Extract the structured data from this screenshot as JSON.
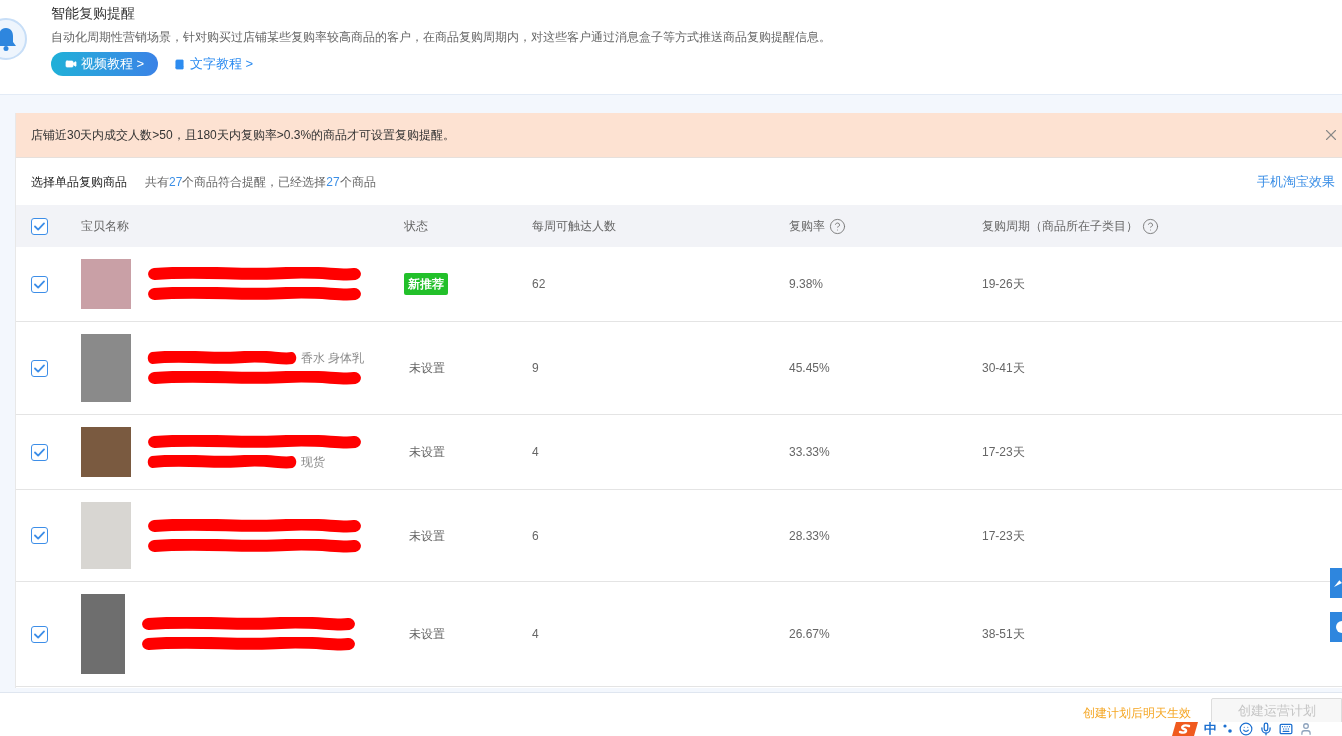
{
  "header": {
    "title": "智能复购提醒",
    "description": "自动化周期性营销场景，针对购买过店铺某些复购率较高商品的客户，在商品复购周期内，对这些客户通过消息盒子等方式推送商品复购提醒信息。",
    "video_button": "视频教程 >",
    "text_link": "文字教程 >"
  },
  "notice": {
    "text": "店铺近30天内成交人数>50，且180天内复购率>0.3%的商品才可设置复购提醒。"
  },
  "selection": {
    "title": "选择单品复购商品",
    "prefix": "共有",
    "total": "27",
    "middle": "个商品符合提醒，已经选择",
    "selected_count": "27",
    "suffix": "个商品",
    "preview_link": "手机淘宝效果"
  },
  "table": {
    "select_all_checked": true,
    "columns": [
      {
        "label": "宝贝名称",
        "help": false
      },
      {
        "label": "状态",
        "help": false
      },
      {
        "label": "每周可触达人数",
        "help": false
      },
      {
        "label": "复购率",
        "help": true
      },
      {
        "label": "复购周期（商品所在子类目）",
        "help": true
      }
    ],
    "rows": [
      {
        "checked": true,
        "name_lines": [
          {
            "redacted": true
          },
          {
            "redacted": true
          }
        ],
        "status": {
          "kind": "badge",
          "text": "新推荐"
        },
        "weekly_reach": "62",
        "repurchase_rate": "9.38%",
        "cycle": "19-26天"
      },
      {
        "checked": true,
        "name_lines": [
          {
            "redacted": true,
            "text": "香水 身体乳"
          },
          {
            "redacted": true
          }
        ],
        "status": {
          "kind": "plain",
          "text": "未设置"
        },
        "weekly_reach": "9",
        "repurchase_rate": "45.45%",
        "cycle": "30-41天"
      },
      {
        "checked": true,
        "name_lines": [
          {
            "redacted": true
          },
          {
            "redacted": true,
            "text": "现货"
          }
        ],
        "status": {
          "kind": "plain",
          "text": "未设置"
        },
        "weekly_reach": "4",
        "repurchase_rate": "33.33%",
        "cycle": "17-23天"
      },
      {
        "checked": true,
        "name_lines": [
          {
            "redacted": true
          },
          {
            "redacted": true
          }
        ],
        "status": {
          "kind": "plain",
          "text": "未设置"
        },
        "weekly_reach": "6",
        "repurchase_rate": "28.33%",
        "cycle": "17-23天"
      },
      {
        "checked": true,
        "name_lines": [
          {
            "redacted": true
          },
          {
            "redacted": true
          }
        ],
        "status": {
          "kind": "plain",
          "text": "未设置"
        },
        "weekly_reach": "4",
        "repurchase_rate": "26.67%",
        "cycle": "38-51天"
      }
    ]
  },
  "footer": {
    "hint": "创建计划后明天生效",
    "create_button": {
      "label": "创建运营计划",
      "disabled": true
    }
  },
  "ime_toolbar": {
    "mode": "中"
  }
}
